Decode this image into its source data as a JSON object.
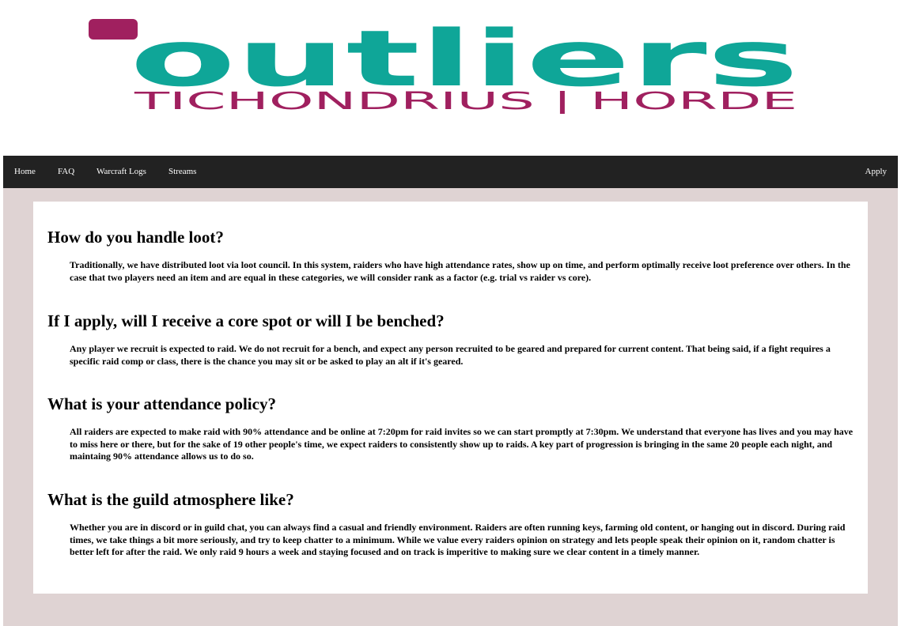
{
  "brand": {
    "logo_word": "outliers",
    "logo_subtitle": "TICHONDRIUS | HORDE",
    "primary_color": "#0fa698",
    "accent_color": "#a0205f"
  },
  "nav": {
    "home": "Home",
    "faq": "FAQ",
    "logs": "Warcraft Logs",
    "streams": "Streams",
    "apply": "Apply"
  },
  "faq": [
    {
      "question": "How do you handle loot?",
      "answer": "Traditionally, we have distributed loot via loot council. In this system, raiders who have high attendance rates, show up on time, and perform optimally receive loot preference over others. In the case that two players need an item and are equal in these categories, we will consider rank as a factor (e.g. trial vs raider vs core)."
    },
    {
      "question": "If I apply, will I receive a core spot or will I be benched?",
      "answer": "Any player we recruit is expected to raid. We do not recruit for a bench, and expect any person recruited to be geared and prepared for current content. That being said, if a fight requires a specific raid comp or class, there is the chance you may sit or be asked to play an alt if it's geared."
    },
    {
      "question": "What is your attendance policy?",
      "answer": "All raiders are expected to make raid with 90% attendance and be online at 7:20pm for raid invites so we can start promptly at 7:30pm. We understand that everyone has lives and you may have to miss here or there, but for the sake of 19 other people's time, we expect raiders to consistently show up to raids. A key part of progression is bringing in the same 20 people each night, and maintaing 90% attendance allows us to do so."
    },
    {
      "question": "What is the guild atmosphere like?",
      "answer": "Whether you are in discord or in guild chat, you can always find a casual and friendly environment. Raiders are often running keys, farming old content, or hanging out in discord. During raid times, we take things a bit more seriously, and try to keep chatter to a minimum. While we value every raiders opinion on strategy and lets people speak their opinion on it, random chatter is better left for after the raid. We only raid 9 hours a week and staying focused and on track is imperitive to making sure we clear content in a timely manner."
    }
  ]
}
